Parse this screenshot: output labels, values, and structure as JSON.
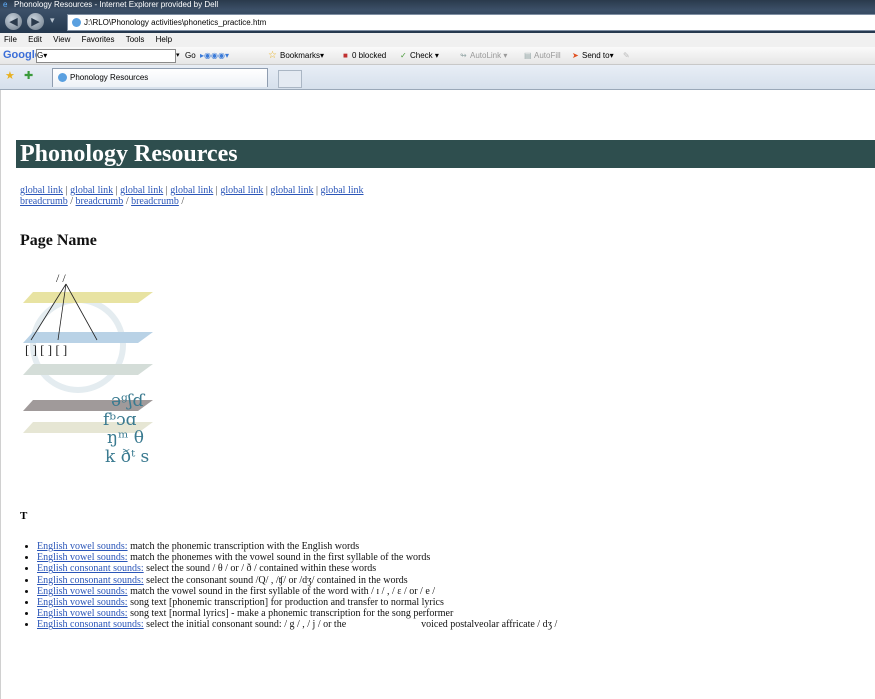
{
  "window": {
    "title": "Phonology Resources - Internet Explorer provided by Dell"
  },
  "address": {
    "url": "J:\\RLO\\Phonology activities\\phonetics_practice.htm"
  },
  "menu": [
    "File",
    "Edit",
    "View",
    "Favorites",
    "Tools",
    "Help"
  ],
  "google_bar": {
    "logo": "Google",
    "search_value": "G▾",
    "go_label": "Go",
    "bookmarks_label": "Bookmarks▾",
    "blocked_label": "0 blocked",
    "check_label": "Check ▾",
    "autolink_label": "AutoLink ▾",
    "autofill_label": "AutoFill",
    "sendto_label": "Send to▾"
  },
  "tab": {
    "label": "Phonology Resources"
  },
  "page": {
    "banner_title": "Phonology Resources",
    "global_links": [
      "global link",
      "global link",
      "global link",
      "global link",
      "global link",
      "global link",
      "global link"
    ],
    "breadcrumbs": [
      "breadcrumb",
      "breadcrumb",
      "breadcrumb"
    ],
    "page_name": "Page Name",
    "section_heading": "T",
    "items": [
      {
        "link": "English vowel sounds:",
        "text": " match the phonemic transcription with the English words"
      },
      {
        "link": "English vowel sounds:",
        "text": " match the phonemes with the vowel sound in the first syllable of the words"
      },
      {
        "link": "English consonant sounds:",
        "text": " select the sound / θ / or / ð / contained within these words"
      },
      {
        "link": "English consonant sounds:",
        "text": " select the consonant sound /Q/ , /ʧ/ or /dʒ/ contained in the words"
      },
      {
        "link": "English vowel sounds:",
        "text": " match the vowel sound in the first syllable of the word with / ɪ / , / ɛ / or / e /"
      },
      {
        "link": "English vowel sounds:",
        "text": " song text [phonemic transcription] for production and transfer to normal lyrics"
      },
      {
        "link": "English vowel sounds:",
        "text": " song text [normal lyrics] - make a phonemic transcription for the song performer"
      },
      {
        "link": "English consonant sounds:",
        "text": " select the initial consonant sound: / g / , / j / or the                              voiced postalveolar affricate / dʒ /"
      }
    ]
  },
  "logo_symbols": {
    "slashes": "/ /",
    "brackets": "[ ] [ ] [ ]",
    "line1": "əᵍʃɗ",
    "line2": "fᵇɔɑ",
    "line3": "ŋᵐ θ",
    "line4": "k ðᵗ s"
  }
}
